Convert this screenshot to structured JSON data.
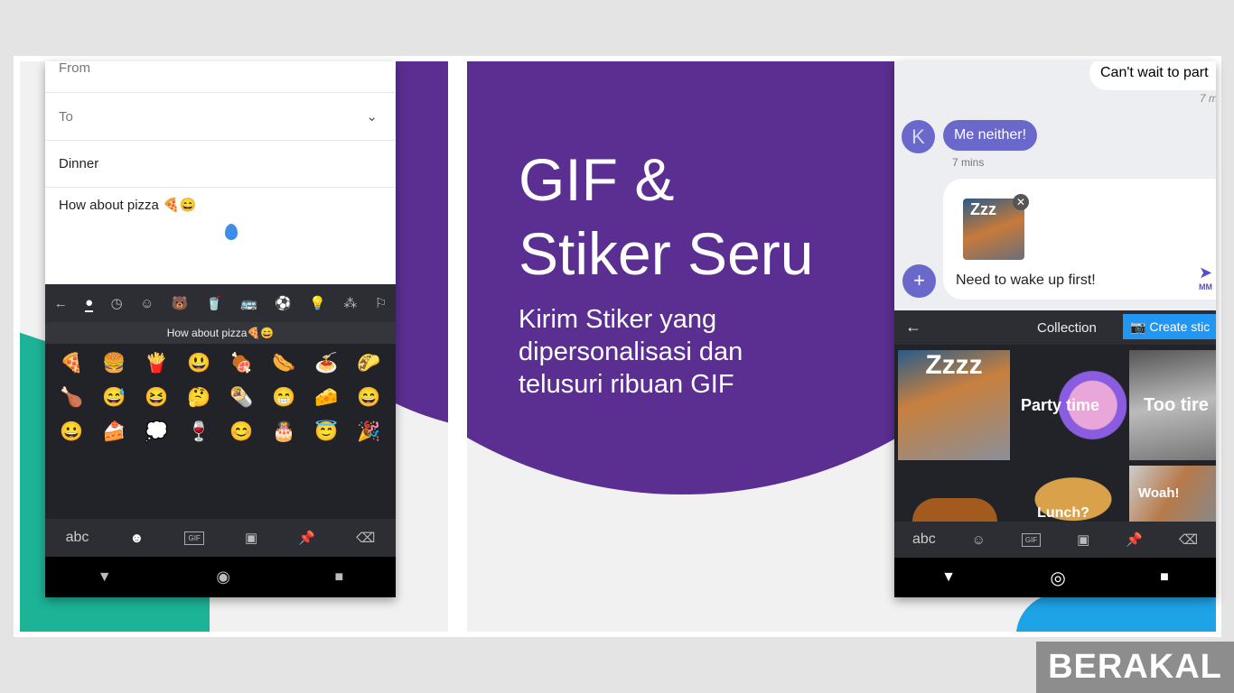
{
  "left_phone": {
    "email": {
      "from_label": "From",
      "to_label": "To",
      "subject": "Dinner",
      "body": "How about pizza 🍕😄"
    },
    "emoji_categories": [
      "back-arrow",
      "people",
      "recent",
      "smileys",
      "animals",
      "food",
      "travel",
      "activities",
      "objects",
      "symbols",
      "flags"
    ],
    "suggestion": "How about pizza🍕😄",
    "emojis": [
      "🍕",
      "🍔",
      "🍟",
      "😃",
      "🍖",
      "🌭",
      "🍝",
      "🌮",
      "🍗",
      "😅",
      "😆",
      "🤔",
      "🌯",
      "😁",
      "🧀",
      "😄",
      "😀",
      "🍰",
      "💭",
      "🍷",
      "😊",
      "🎂",
      "😇",
      "🎉"
    ],
    "bottom_bar": {
      "abc": "abc",
      "gif": "GIF"
    }
  },
  "promo": {
    "title_line1": "GIF &",
    "title_line2": "Stiker Seru",
    "subtitle": [
      "Kirim Stiker yang",
      "dipersonalisasi dan",
      "telusuri ribuan GIF"
    ]
  },
  "right_phone": {
    "msg_out": "Can't wait to part",
    "msg_out_time": "7 m",
    "avatar_letter": "K",
    "msg_in": "Me neither!",
    "msg_in_time": "7 mins",
    "attachment_text": "Zzz",
    "compose_text": "Need to wake up first!",
    "send_label": "MM",
    "collection_label": "Collection",
    "create_sticker_label": "Create stic",
    "stickers": [
      "Zzzz",
      "Party time",
      "Too tire",
      "Lunch?",
      "Woah!"
    ],
    "bottom_bar": {
      "abc": "abc",
      "gif": "GIF"
    }
  },
  "watermark": "BERAKAL",
  "colors": {
    "purple": "#5b2e91",
    "teal": "#1db396",
    "accent_blue": "#2196f3",
    "bubble_purple": "#6b68cc"
  }
}
